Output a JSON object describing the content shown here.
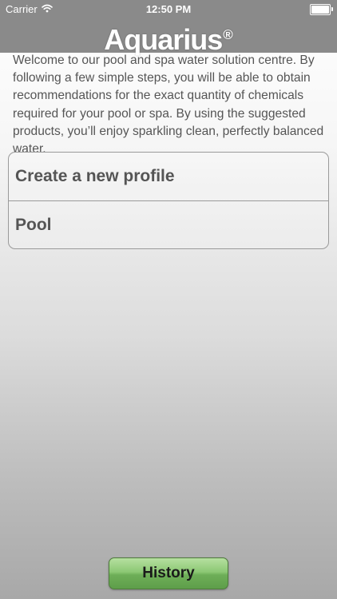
{
  "status_bar": {
    "carrier": "Carrier",
    "time": "12:50 PM",
    "battery_level": 1.0
  },
  "header": {
    "logo_text": "Aquarius",
    "logo_mark": "®"
  },
  "intro_text": "Welcome to our pool and spa water solution centre. By following a few simple steps, you will be able to obtain recommendations for the exact quantity of chemicals required for your pool or spa. By using the suggested products, you’ll enjoy sparkling clean, perfectly balanced water.",
  "profiles": {
    "items": [
      {
        "label": "Create a new profile"
      },
      {
        "label": "Pool"
      }
    ]
  },
  "footer": {
    "history_label": "History"
  },
  "colors": {
    "topbar": "#8a8a8a",
    "text": "#555555",
    "button_green": "#8cc874"
  }
}
